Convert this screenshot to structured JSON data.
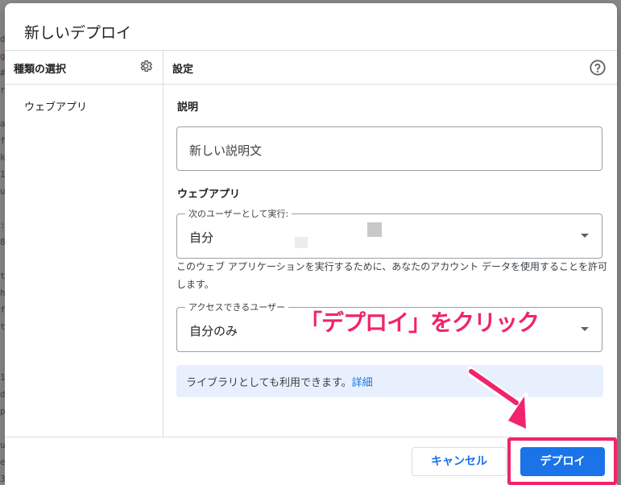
{
  "dialog": {
    "title": "新しいデプロイ"
  },
  "left_panel": {
    "header": "種類の選択",
    "items": [
      {
        "label": "ウェブアプリ"
      }
    ]
  },
  "right_panel": {
    "header": "設定",
    "description": {
      "label": "説明",
      "value": "新しい説明文"
    },
    "webapp": {
      "section_label": "ウェブアプリ",
      "execute_as": {
        "legend": "次のユーザーとして実行:",
        "value": "自分"
      },
      "note": "このウェブ アプリケーションを実行するために、あなたのアカウント データを使用することを許可します。",
      "access": {
        "legend": "アクセスできるユーザー",
        "value": "自分のみ"
      }
    },
    "info": {
      "text": "ライブラリとしても利用できます。",
      "link": "詳細"
    }
  },
  "footer": {
    "cancel_label": "キャンセル",
    "deploy_label": "デプロイ"
  },
  "annotation": {
    "text": "「デプロイ」をクリック",
    "color": "#f0246c"
  },
  "colors": {
    "primary": "#1a73e8",
    "info_bg": "#e8f0fe",
    "border": "#dadce0"
  }
}
